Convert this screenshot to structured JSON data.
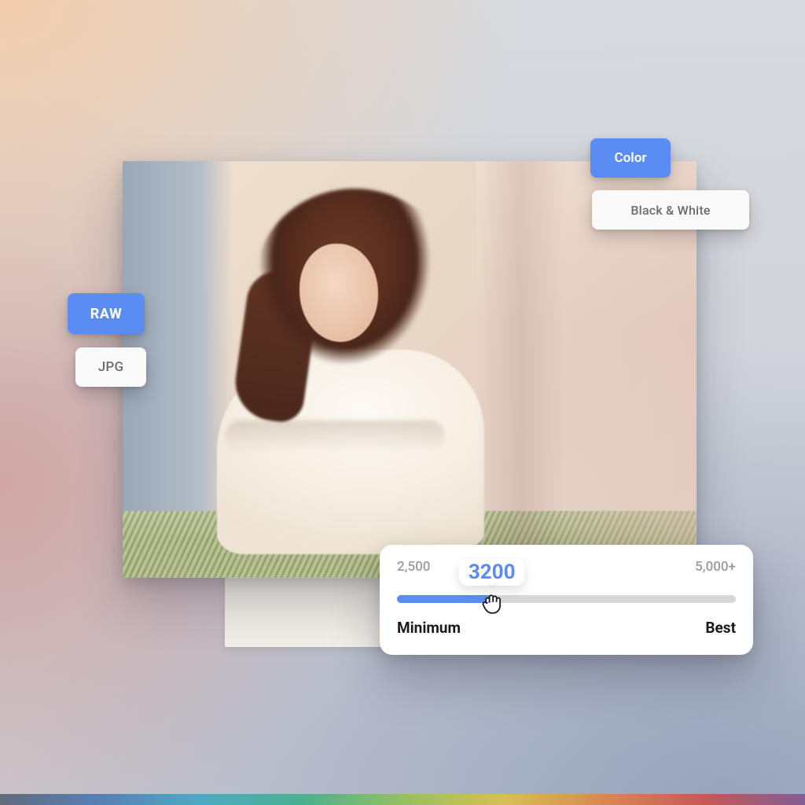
{
  "format_buttons": {
    "raw": "RAW",
    "jpg": "JPG"
  },
  "color_buttons": {
    "color": "Color",
    "bw": "Black & White"
  },
  "slider": {
    "min_display": "2,500",
    "max_display": "5,000+",
    "min_label": "Minimum",
    "max_label": "Best",
    "value_display": "3200",
    "min": 2500,
    "max": 5000,
    "value": 3200
  }
}
